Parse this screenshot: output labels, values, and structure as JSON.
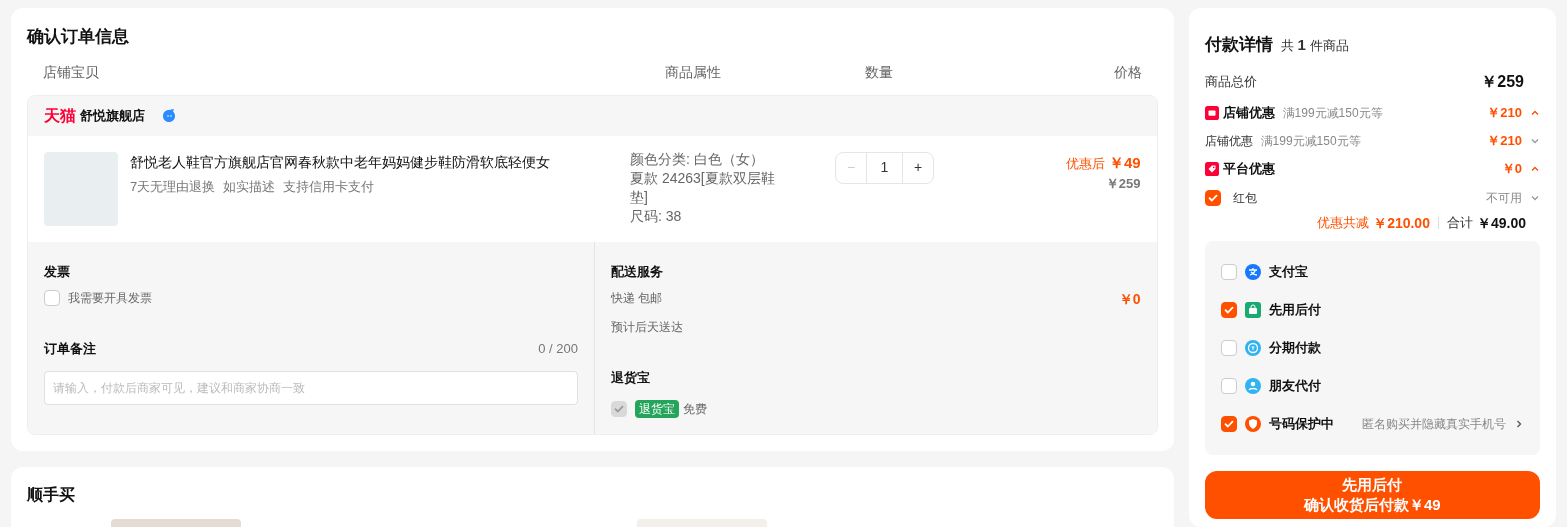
{
  "order": {
    "title": "确认订单信息",
    "columns": [
      "店铺宝贝",
      "商品属性",
      "数量",
      "价格"
    ],
    "shop": {
      "platform": "天猫",
      "name": "舒悦旗舰店"
    },
    "item": {
      "title": "舒悦老人鞋官方旗舰店官网春秋款中老年妈妈健步鞋防滑软底轻便女",
      "services": [
        "7天无理由退换",
        "如实描述",
        "支持信用卡支付"
      ],
      "attributes": [
        "颜色分类: 白色（女）",
        "夏款 24263[夏款双层鞋垫]",
        "尺码: 38"
      ],
      "quantity": "1",
      "minus": "−",
      "plus": "+",
      "discount_label": "优惠后",
      "discount_price": "￥49",
      "original_price": "￥259"
    },
    "invoice": {
      "title": "发票",
      "option": "我需要开具发票",
      "checked": false
    },
    "note": {
      "title": "订单备注",
      "count": "0 / 200",
      "placeholder": "请输入，付款后商家可见，建议和商家协商一致"
    },
    "delivery": {
      "title": "配送服务",
      "method": "快递 包邮",
      "eta": "预计后天送达",
      "price": "￥0"
    },
    "return_insurance": {
      "title": "退货宝",
      "checked": true,
      "disabled": true,
      "tag": "退货宝",
      "price": "免费"
    }
  },
  "recommend": {
    "title": "顺手买"
  },
  "payment": {
    "title": "付款详情",
    "count_prefix": "共",
    "count": "1",
    "count_suffix": "件商品",
    "total_label": "商品总价",
    "total": "￥259",
    "store_discount": {
      "label": "店铺优惠",
      "desc": "满199元减150元等",
      "amount": "￥210",
      "expanded": true
    },
    "store_discount_detail": {
      "label": "店铺优惠",
      "desc": "满199元减150元等",
      "amount": "￥210",
      "expanded": false
    },
    "platform_discount": {
      "label": "平台优惠",
      "amount": "￥0",
      "expanded": true
    },
    "red_packet": {
      "label": "红包",
      "checked": true,
      "status": "不可用"
    },
    "saved_label": "优惠共减",
    "saved": "￥210.00",
    "sum_label": "合计",
    "sum": "￥49.00",
    "methods": [
      {
        "kind": "alipay",
        "label": "支付宝",
        "checked": false
      },
      {
        "kind": "paylater",
        "label": "先用后付",
        "checked": true
      },
      {
        "kind": "installment",
        "label": "分期付款",
        "checked": false
      },
      {
        "kind": "friend",
        "label": "朋友代付",
        "checked": false
      },
      {
        "kind": "privacy",
        "label": "号码保护中",
        "checked": true,
        "hint": "匿名购买并隐藏真实手机号"
      }
    ],
    "button": {
      "line1": "先用后付",
      "line2": "确认收货后付款￥49"
    }
  }
}
